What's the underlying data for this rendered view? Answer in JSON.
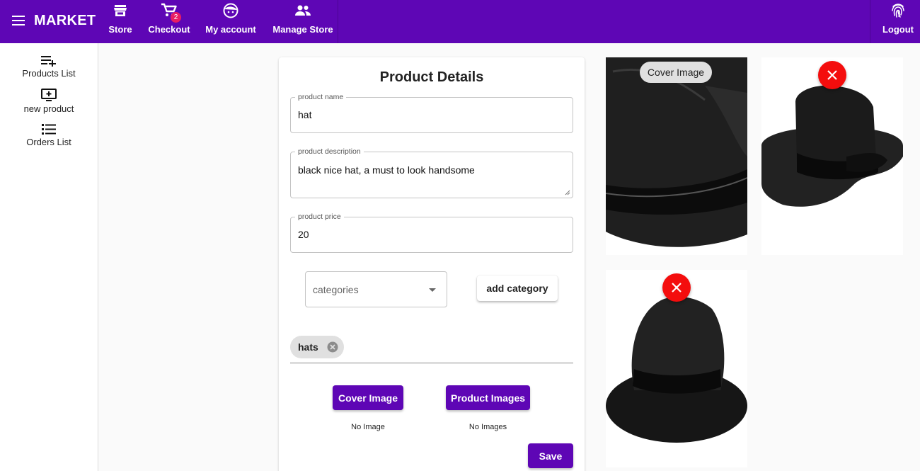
{
  "app": {
    "brand": "MARKET"
  },
  "nav": {
    "store": "Store",
    "checkout": "Checkout",
    "checkout_badge": "2",
    "account": "My account",
    "manage": "Manage Store",
    "logout": "Logout"
  },
  "sidebar": {
    "items": [
      {
        "label": "Products List",
        "icon": "playlist-add-icon"
      },
      {
        "label": "new product",
        "icon": "add-to-queue-icon"
      },
      {
        "label": "Orders List",
        "icon": "list-icon"
      }
    ]
  },
  "form": {
    "title": "Product Details",
    "name": {
      "label": "product name",
      "value": "hat"
    },
    "description": {
      "label": "product description",
      "value": "black nice hat, a must to look handsome"
    },
    "price": {
      "label": "product price",
      "value": "20"
    },
    "categories_placeholder": "categories",
    "add_category_label": "add category",
    "chips": [
      "hats"
    ],
    "cover_image_label": "Cover Image",
    "product_images_label": "Product Images",
    "cover_status": "No Image",
    "images_status": "No Images",
    "save_label": "Save"
  },
  "images": {
    "cover_label": "Cover Image"
  },
  "colors": {
    "primary": "#5e06b5",
    "badge": "#e91e63",
    "delete": "#f40d0d"
  }
}
